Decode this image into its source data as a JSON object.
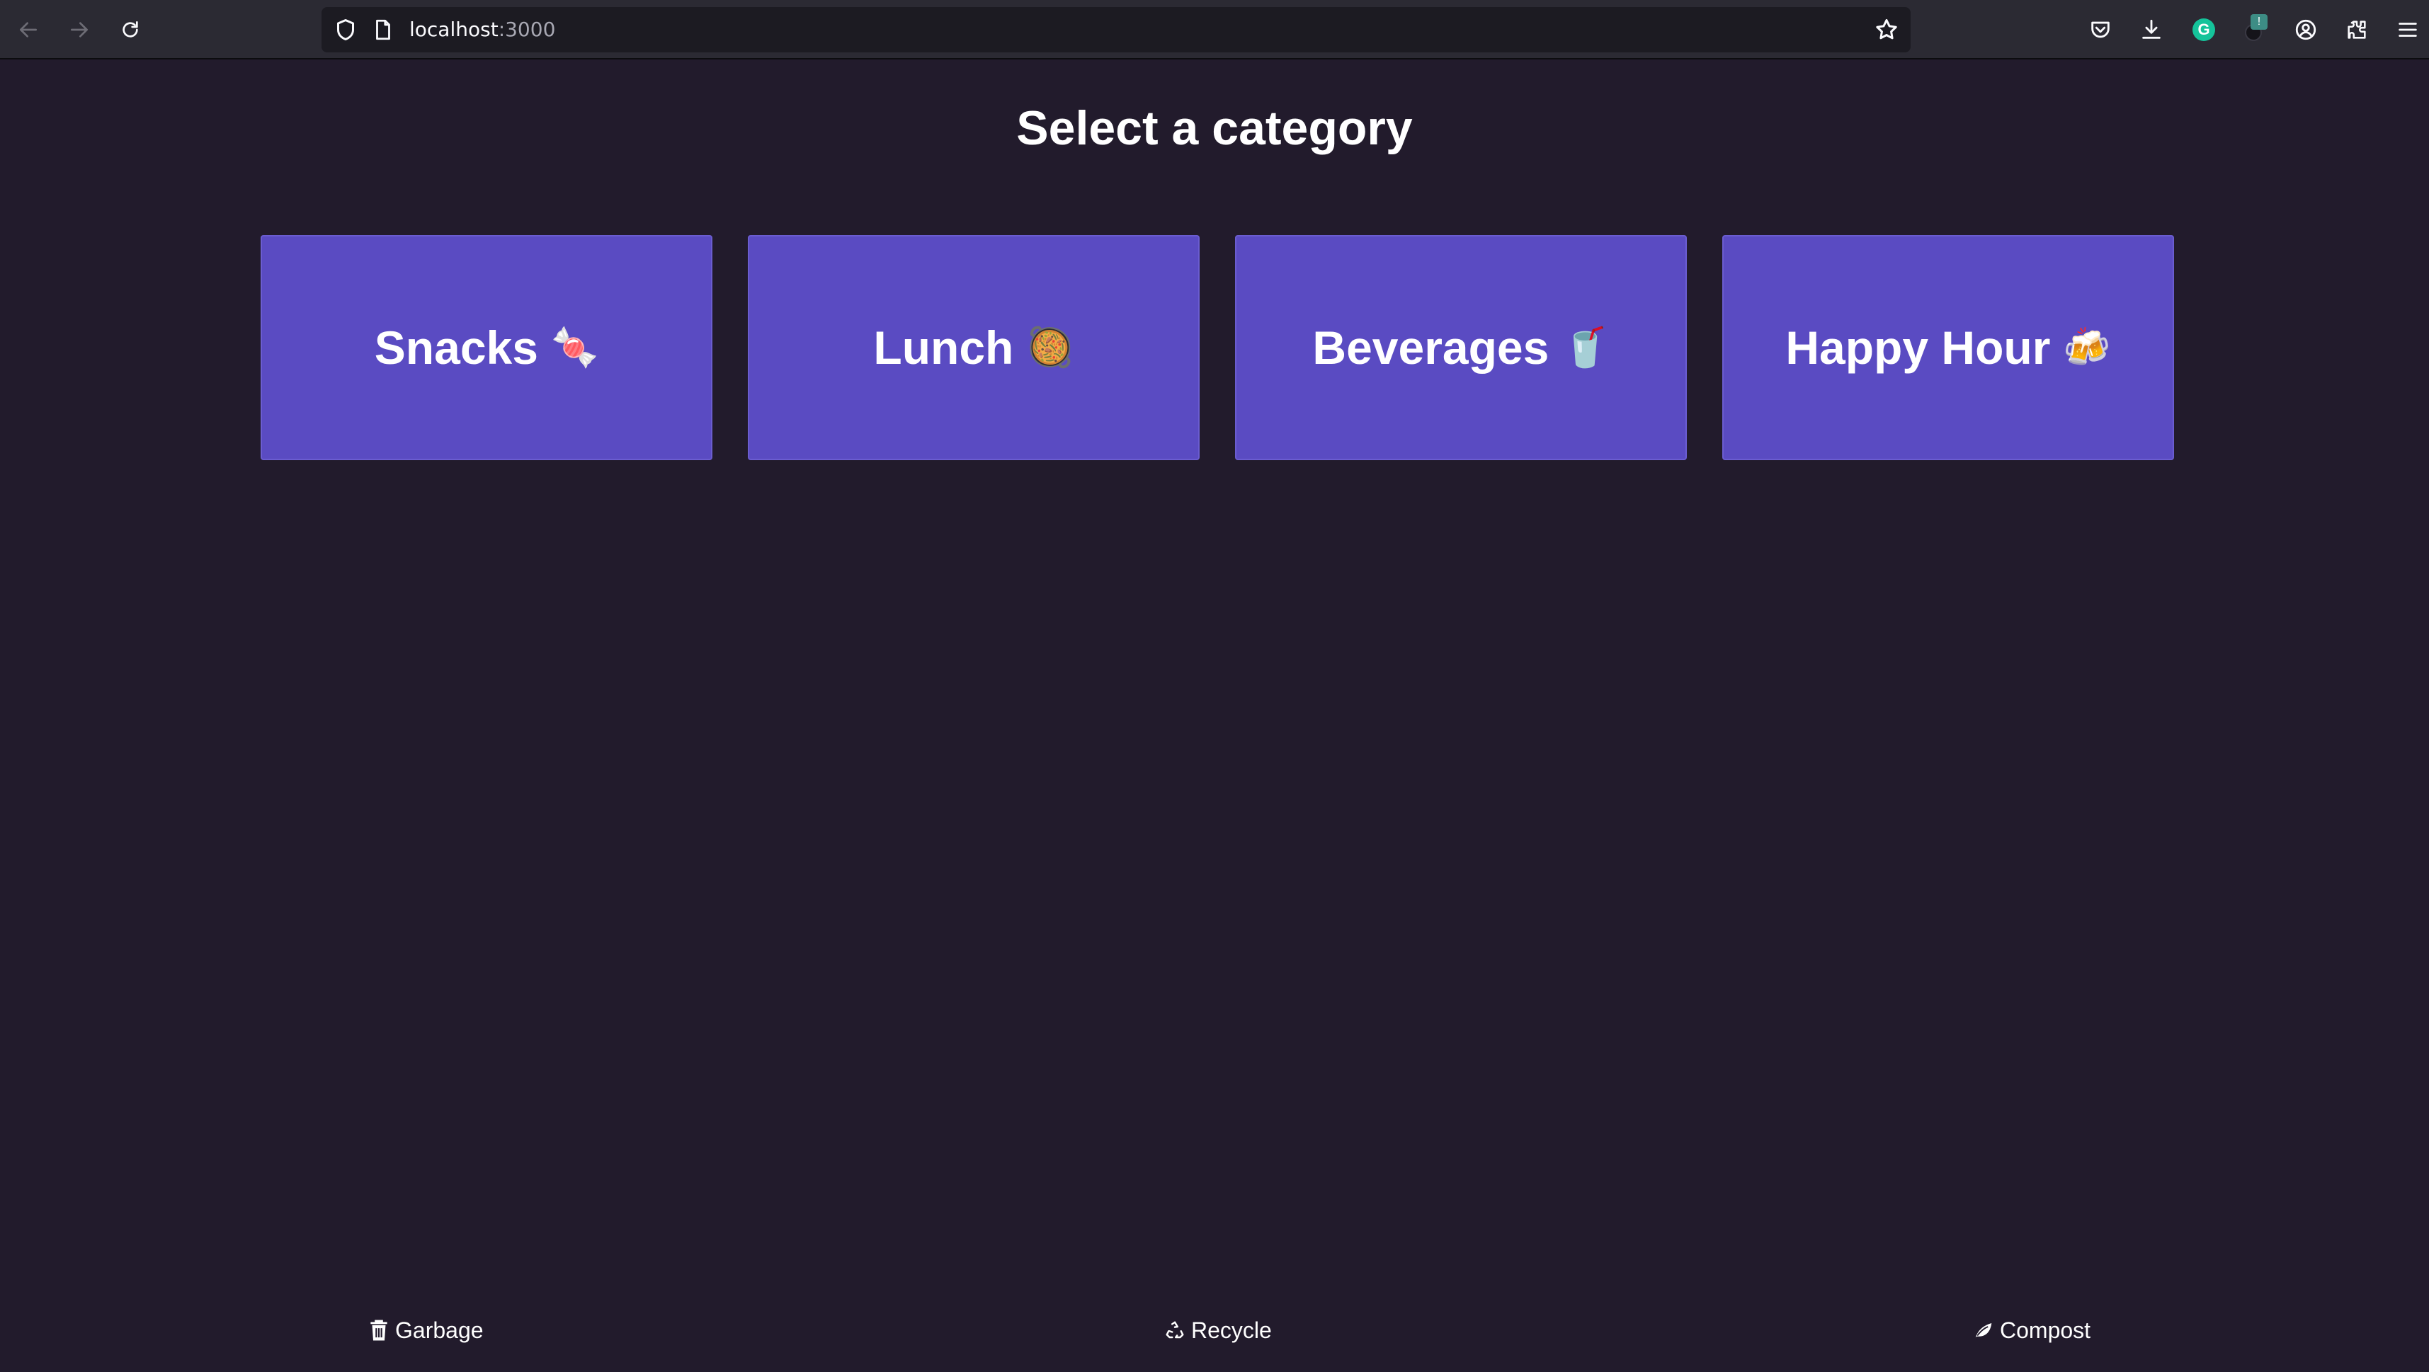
{
  "browser": {
    "url_host": "localhost",
    "url_port": ":3000",
    "icons": [
      "back-arrow-icon",
      "forward-arrow-icon",
      "reload-icon",
      "shield-icon",
      "page-icon",
      "star-icon",
      "pocket-icon",
      "download-icon",
      "grammarly-icon",
      "extension-badge-icon",
      "account-icon",
      "extensions-icon",
      "menu-icon"
    ],
    "grammarly_letter": "G",
    "badge_text": "!"
  },
  "page": {
    "title": "Select a category"
  },
  "categories": [
    {
      "label": "Snacks",
      "emoji": "🍬"
    },
    {
      "label": "Lunch",
      "emoji": "🥘"
    },
    {
      "label": "Beverages",
      "emoji": "🥤"
    },
    {
      "label": "Happy Hour",
      "emoji": "🍻"
    }
  ],
  "footer": {
    "garbage": "Garbage",
    "recycle": "Recycle",
    "compost": "Compost"
  },
  "colors": {
    "background": "#221b2c",
    "card": "#5a4bc2",
    "chrome": "#2b2a33"
  }
}
